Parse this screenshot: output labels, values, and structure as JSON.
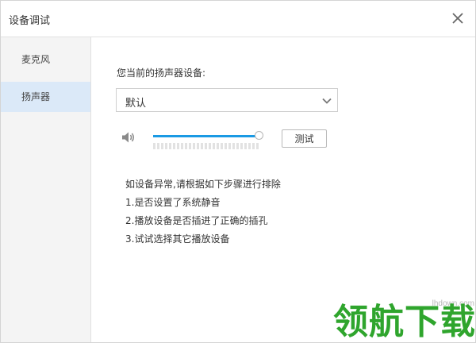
{
  "window": {
    "title": "设备调试"
  },
  "sidebar": {
    "items": [
      {
        "label": "麦克风",
        "selected": false
      },
      {
        "label": "扬声器",
        "selected": true
      }
    ]
  },
  "speaker": {
    "device_label": "您当前的扬声器设备:",
    "selected_device": "默认",
    "volume_fraction": 1.0,
    "test_button_label": "测试"
  },
  "tips": {
    "heading": "如设备异常,请根据如下步骤进行排除",
    "steps": [
      "1.是否设置了系统静音",
      "2.播放设备是否插进了正确的插孔",
      "3.试试选择其它播放设备"
    ]
  },
  "watermark": {
    "text": "领航下载",
    "url": "lhdown.com"
  },
  "colors": {
    "accent": "#1a9ae4",
    "selected_bg": "#dbe9f8",
    "sidebar_bg": "#f4f4f4",
    "watermark": "#2fa52d"
  },
  "icons": {
    "close": "close-icon",
    "dropdown": "chevron-down-icon",
    "volume": "speaker-volume-icon"
  }
}
